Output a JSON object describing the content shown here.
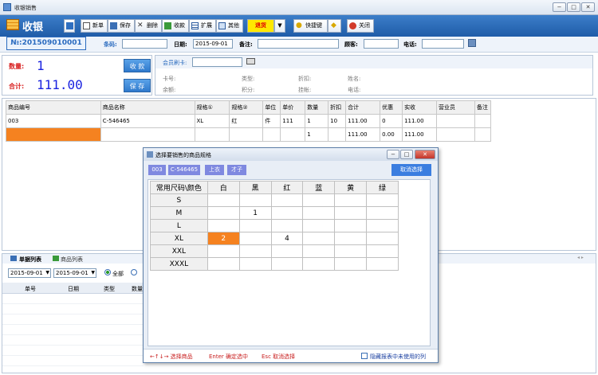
{
  "window": {
    "title": "收银销售",
    "btn_min": "−",
    "btn_max": "□",
    "btn_close": "✕"
  },
  "app": {
    "title": "收银"
  },
  "toolbar": {
    "new": "新单",
    "save": "保存",
    "delete": "删除",
    "collect": "收款",
    "expand": "扩展",
    "other": "其他",
    "return": "退货",
    "shortcut": "快捷键",
    "close": "关闭"
  },
  "order": {
    "number": "№:201509010001",
    "barcode_label": "条码:",
    "date_label": "日期:",
    "date": "2015-09-01",
    "note_label": "备注:",
    "customer_label": "顾客:",
    "phone_label": "电话:"
  },
  "summary": {
    "qty_label": "数量:",
    "qty": "1",
    "total_label": "合计:",
    "total": "111.00",
    "collect_btn": "收 款",
    "save_btn": "保 存"
  },
  "member": {
    "card_label": "会员刷卡:",
    "card_no": "卡号:",
    "type": "类型:",
    "discount": "折扣:",
    "name": "姓名:",
    "balance": "余额:",
    "points": "积分:",
    "debt": "挂帐:",
    "phone": "电话:"
  },
  "grid": {
    "headers": [
      "商品编号",
      "商品名称",
      "规格①",
      "规格②",
      "单位",
      "单价",
      "数量",
      "折扣",
      "合计",
      "优惠",
      "实收",
      "营业员",
      "备注"
    ],
    "rows": [
      [
        "003",
        "C-546465",
        "XL",
        "红",
        "件",
        "111",
        "1",
        "10",
        "111.00",
        "0",
        "111.00",
        "",
        ""
      ],
      [
        "",
        "",
        "",
        "",
        "",
        "",
        "1",
        "",
        "111.00",
        "0.00",
        "111.00",
        "",
        ""
      ]
    ]
  },
  "bottom": {
    "tab1": "单据列表",
    "tab2": "商品列表",
    "date_from": "2015-09-01",
    "date_to": "2015-09-01",
    "radio_all": "全部",
    "cols": [
      "单号",
      "日期",
      "类型",
      "数量"
    ]
  },
  "dialog": {
    "title": "选择要销售的商品规格",
    "chip1": "003",
    "chip2": "C-546465",
    "chip3": "上衣",
    "chip4": "才子",
    "cancel": "取消选择",
    "corner": "常用尺码\\颜色",
    "colors": [
      "白",
      "黑",
      "红",
      "蓝",
      "黄",
      "绿"
    ],
    "sizes": [
      {
        "name": "S",
        "cells": [
          "",
          "",
          "",
          "",
          "",
          ""
        ]
      },
      {
        "name": "M",
        "cells": [
          "",
          "1",
          "",
          "",
          "",
          ""
        ]
      },
      {
        "name": "L",
        "cells": [
          "",
          "",
          "",
          "",
          "",
          ""
        ]
      },
      {
        "name": "XL",
        "cells": [
          "2",
          "",
          "4",
          "",
          "",
          ""
        ]
      },
      {
        "name": "XXL",
        "cells": [
          "",
          "",
          "",
          "",
          "",
          ""
        ]
      },
      {
        "name": "XXXL",
        "cells": [
          "",
          "",
          "",
          "",
          "",
          ""
        ]
      }
    ],
    "hint_arrows": "←↑↓→ 选择商品",
    "hint_enter": "Enter 确定选中",
    "hint_esc": "Esc 取消选择",
    "hide_unused": "隐藏报表中未使用的列"
  },
  "colors": {
    "accent": "#2a6bbf",
    "highlight": "#f58220",
    "chip": "#7f89e0",
    "digits": "#1a22e0"
  }
}
